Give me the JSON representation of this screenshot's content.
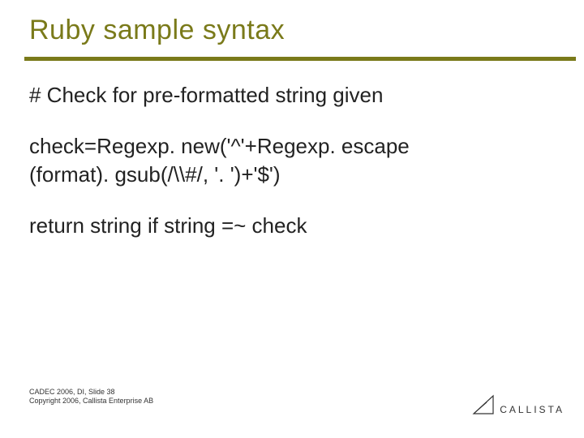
{
  "title": "Ruby sample syntax",
  "body": {
    "comment": "#  Check for pre-formatted string given",
    "code1": "check=Regexp. new('^'+Regexp. escape",
    "code2": "(format). gsub(/\\\\#/, '. ')+'$')",
    "ret": "return string if string =~ check"
  },
  "footer": {
    "line1": "CADEC 2006, DI, Slide 38",
    "line2": "Copyright 2006, Callista Enterprise AB"
  },
  "logo_text": "CALLISTA"
}
